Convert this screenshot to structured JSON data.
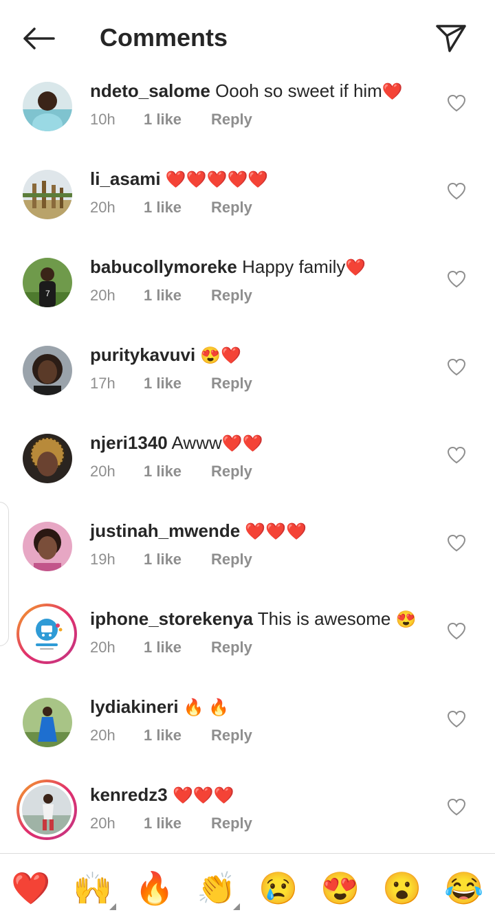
{
  "header": {
    "title": "Comments"
  },
  "comments": [
    {
      "username": "ndeto_salome",
      "text": "Oooh so sweet if him",
      "emoji": "❤️",
      "time": "10h",
      "likes": "1 like",
      "reply": "Reply"
    },
    {
      "username": "li_asami",
      "text": "",
      "emoji": "❤️❤️❤️❤️❤️",
      "time": "20h",
      "likes": "1 like",
      "reply": "Reply"
    },
    {
      "username": "babucollymoreke",
      "text": "Happy family",
      "emoji": "❤️",
      "time": "20h",
      "likes": "1 like",
      "reply": "Reply"
    },
    {
      "username": "puritykavuvi",
      "text": "",
      "emoji": "😍❤️",
      "time": "17h",
      "likes": "1 like",
      "reply": "Reply"
    },
    {
      "username": "njeri1340",
      "text": "Awww",
      "emoji": "❤️❤️",
      "time": "20h",
      "likes": "1 like",
      "reply": "Reply"
    },
    {
      "username": "justinah_mwende",
      "text": "",
      "emoji": "❤️❤️❤️",
      "time": "19h",
      "likes": "1 like",
      "reply": "Reply"
    },
    {
      "username": "iphone_storekenya",
      "text": "This is awesome",
      "emoji": "😍",
      "time": "20h",
      "likes": "1 like",
      "reply": "Reply"
    },
    {
      "username": "lydiakineri",
      "text": "",
      "emoji": "🔥 🔥",
      "time": "20h",
      "likes": "1 like",
      "reply": "Reply"
    },
    {
      "username": "kenredz3",
      "text": "",
      "emoji": "❤️❤️❤️",
      "time": "20h",
      "likes": "1 like",
      "reply": "Reply"
    }
  ],
  "reactions": [
    "❤️",
    "🙌",
    "🔥",
    "👏",
    "😢",
    "😍",
    "😮",
    "😂"
  ],
  "colors": {
    "heart": "#ed4956",
    "muted": "#8e8e8e",
    "text": "#262626",
    "divider": "#dbdbdb"
  }
}
